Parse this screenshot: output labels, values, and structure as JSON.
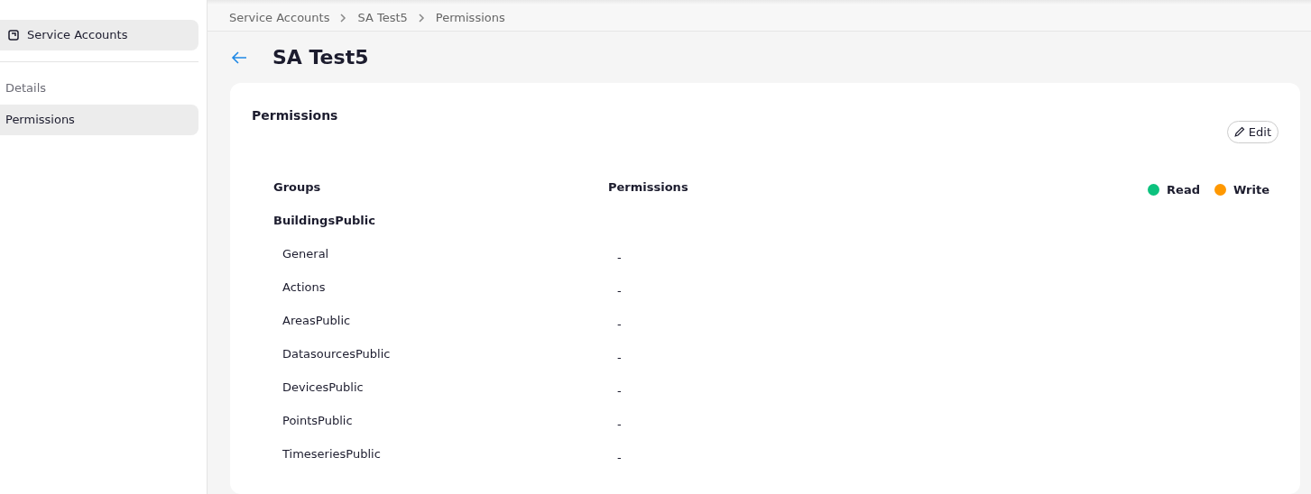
{
  "sidebar": {
    "header": {
      "label": "Service Accounts",
      "selected": true
    },
    "items": [
      {
        "label": "Details",
        "selected": false
      },
      {
        "label": "Permissions",
        "selected": true
      }
    ]
  },
  "breadcrumb": [
    "Service Accounts",
    "SA Test5",
    "Permissions"
  ],
  "page_title": "SA Test5",
  "card": {
    "title": "Permissions",
    "edit_button": "Edit",
    "legend": [
      {
        "label": "Read",
        "color": "#0cc27e"
      },
      {
        "label": "Write",
        "color": "#ff9800"
      }
    ],
    "table": {
      "columns": [
        "Groups",
        "Permissions"
      ],
      "groups": [
        {
          "name": "BuildingsPublic",
          "children": [
            {
              "name": "General",
              "permission": "-"
            },
            {
              "name": "Actions",
              "permission": "-"
            },
            {
              "name": "AreasPublic",
              "permission": "-"
            },
            {
              "name": "DatasourcesPublic",
              "permission": "-"
            },
            {
              "name": "DevicesPublic",
              "permission": "-"
            },
            {
              "name": "PointsPublic",
              "permission": "-"
            },
            {
              "name": "TimeseriesPublic",
              "permission": "-"
            }
          ]
        }
      ]
    }
  }
}
